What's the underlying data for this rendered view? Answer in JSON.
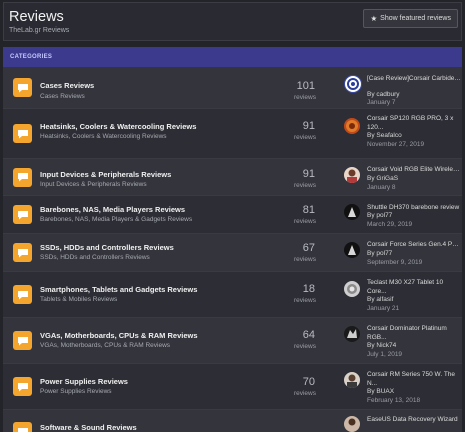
{
  "header": {
    "title": "Reviews",
    "subtitle": "TheLab.gr Reviews",
    "featured_button": "Show featured reviews"
  },
  "category_label": "CATEGORIES",
  "count_label": "reviews",
  "forums": [
    {
      "title": "Cases Reviews",
      "desc": "Cases Reviews",
      "count": "101",
      "last_title": "[Case Review]Corsair Carbide S...",
      "last_by": "By cadbury",
      "last_date": "January 7"
    },
    {
      "title": "Heatsinks, Coolers & Watercooling Reviews",
      "desc": "Heatsinks, Coolers & Watercooling Reviews",
      "count": "91",
      "last_title": "Corsair SP120 RGB PRO, 3 x 120...",
      "last_by": "By Seafalco",
      "last_date": "November 27, 2019"
    },
    {
      "title": "Input Devices & Peripherals Reviews",
      "desc": "Input Devices & Peripherals Reviews",
      "count": "91",
      "last_title": "Corsair Void RGB Elite Wireles...",
      "last_by": "By GriGaS",
      "last_date": "January 8"
    },
    {
      "title": "Barebones, NAS, Media Players Reviews",
      "desc": "Barebones, NAS, Media Players & Gadgets Reviews",
      "count": "81",
      "last_title": "Shuttle DH370 barebone review",
      "last_by": "By pol77",
      "last_date": "March 29, 2019"
    },
    {
      "title": "SSDs, HDDs and Controllers Reviews",
      "desc": "SSDs, HDDs and Controllers Reviews",
      "count": "67",
      "last_title": "Corsair Force Series Gen.4 PCI...",
      "last_by": "By pol77",
      "last_date": "September 9, 2019"
    },
    {
      "title": "Smartphones, Tablets and Gadgets Reviews",
      "desc": "Tablets & Mobiles Reviews",
      "count": "18",
      "last_title": "Teclast M30 X27 Tablet 10 Core...",
      "last_by": "By alfasif",
      "last_date": "January 21"
    },
    {
      "title": "VGAs, Motherboards, CPUs & RAM Reviews",
      "desc": "VGAs, Motherboards, CPUs & RAM Reviews",
      "count": "64",
      "last_title": "Corsair Dominator Platinum RGB...",
      "last_by": "By Nick74",
      "last_date": "July 1, 2019"
    },
    {
      "title": "Power Supplies Reviews",
      "desc": "Power Supplies Reviews",
      "count": "70",
      "last_title": "Corsair RM Series 750 W. The N...",
      "last_by": "By BUAX",
      "last_date": "February 13, 2018"
    },
    {
      "title": "Software & Sound Reviews",
      "desc": "",
      "count": "",
      "last_title": "EaseUS Data Recovery Wizard",
      "last_by": "",
      "last_date": ""
    }
  ],
  "colors": {
    "accent": "#f4a52e",
    "category_bar": "#3c3a8d"
  }
}
